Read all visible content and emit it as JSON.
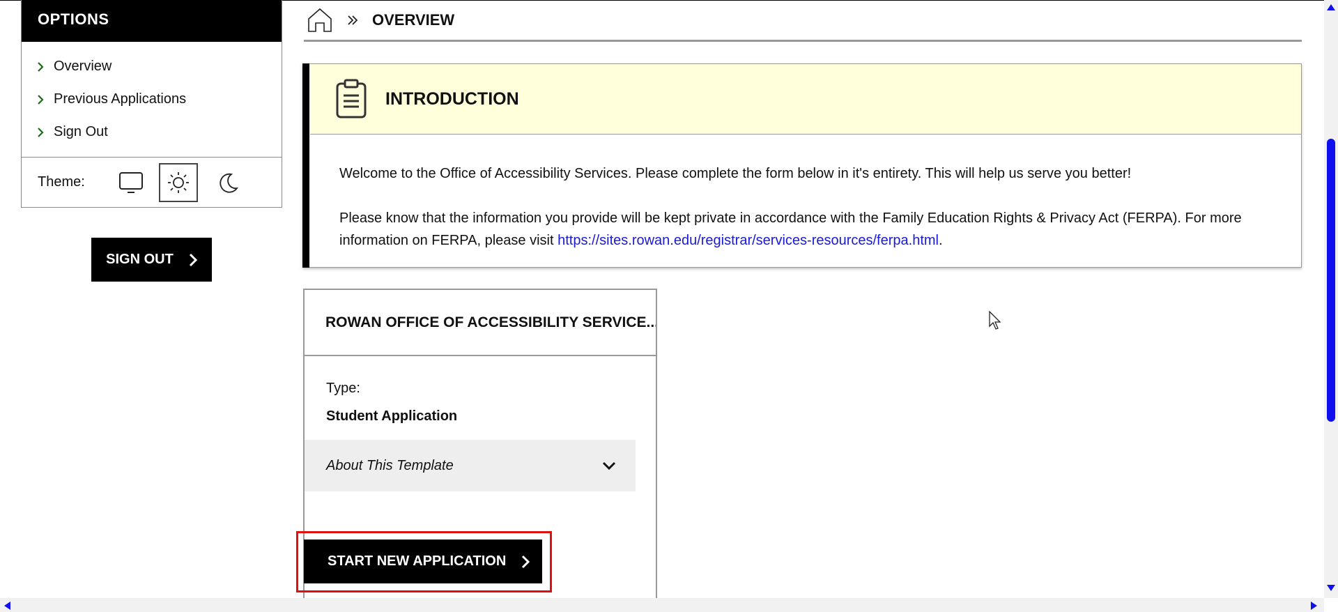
{
  "sidebar": {
    "title": "OPTIONS",
    "items": [
      {
        "label": "Overview"
      },
      {
        "label": "Previous Applications"
      },
      {
        "label": "Sign Out"
      }
    ],
    "theme_label": "Theme:",
    "theme_options": [
      "monitor-icon",
      "sun-icon",
      "moon-icon"
    ],
    "theme_selected": "sun-icon"
  },
  "signout_button": {
    "label": "SIGN OUT"
  },
  "breadcrumb": {
    "current": "OVERVIEW"
  },
  "intro": {
    "title": "INTRODUCTION",
    "paragraph1": "Welcome to the Office of Accessibility Services. Please complete the form below in it's entirety. This will help us serve you better!",
    "paragraph2_text": "Please know that the information you provide will be kept private in accordance with the Family Education Rights & Privacy Act (FERPA). For more information on FERPA, please visit ",
    "paragraph2_link": "https://sites.rowan.edu/registrar/services-resources/ferpa.html",
    "paragraph2_end": "."
  },
  "template_card": {
    "title": "ROWAN OFFICE OF ACCESSIBILITY SERVICE...",
    "type_label": "Type:",
    "type_value": "Student Application",
    "accordion_label": "About This Template",
    "start_button": "START NEW APPLICATION"
  },
  "colors": {
    "accent": "#000000",
    "intro_header_bg": "#ffffdc",
    "link": "#1a1ad6",
    "highlight": "#e01010",
    "scrollbar": "#1010ee"
  }
}
